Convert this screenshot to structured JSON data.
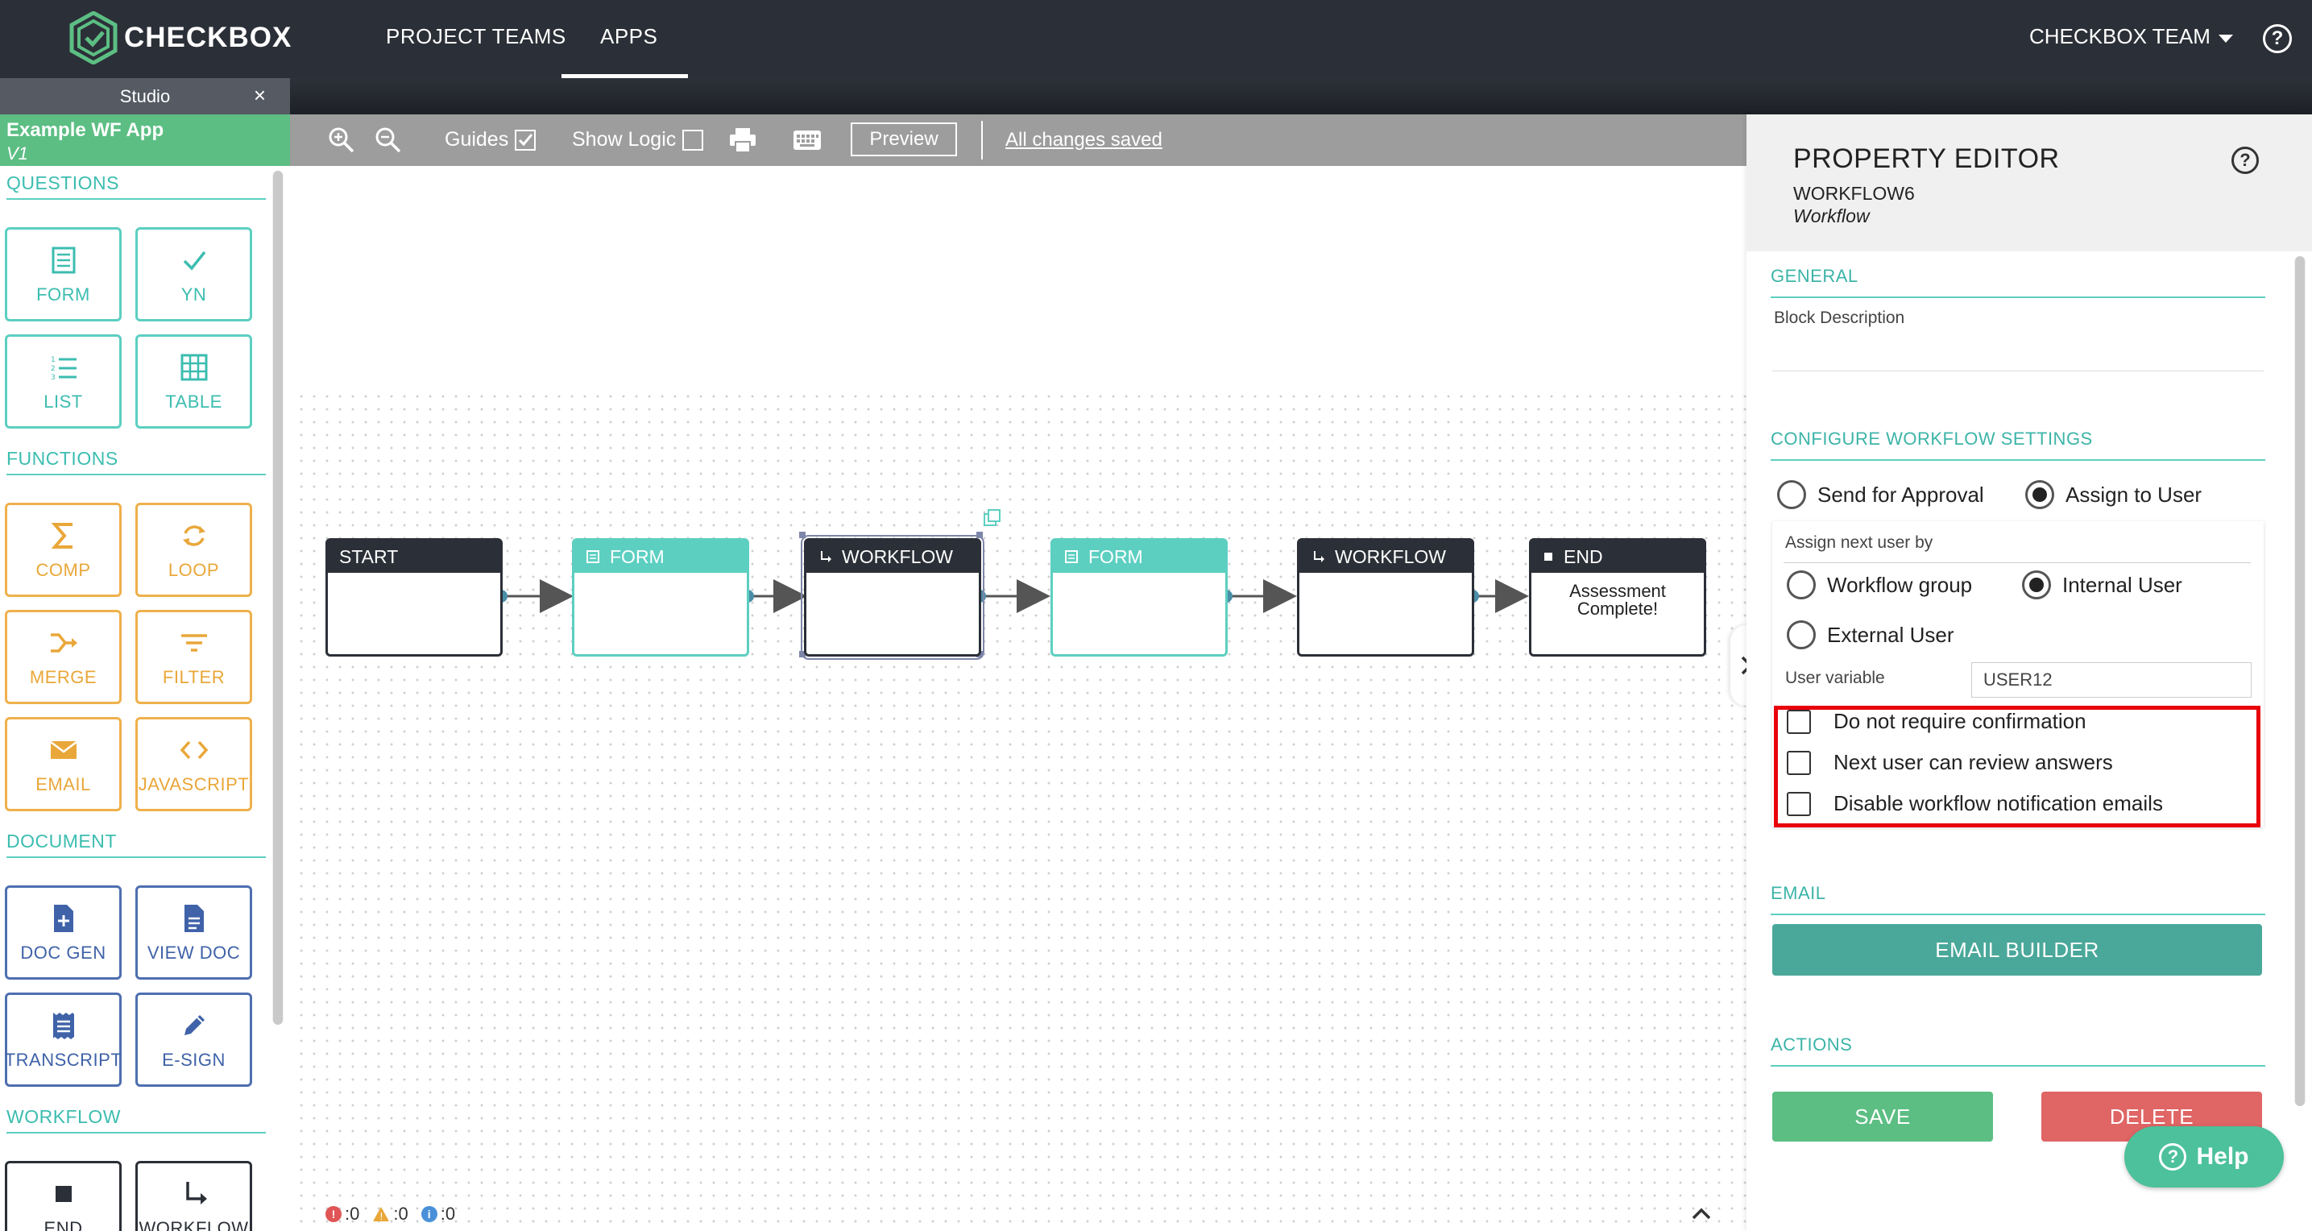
{
  "brand": {
    "name": "CHECKBOX",
    "accent": "#5cbe83"
  },
  "nav": {
    "tabs": [
      {
        "label": "PROJECT TEAMS"
      },
      {
        "label": "APPS"
      }
    ],
    "team_label": "CHECKBOX TEAM",
    "help_glyph": "?"
  },
  "studio": {
    "tab_label": "Studio",
    "close_glyph": "×"
  },
  "app": {
    "name": "Example WF App",
    "version": "V1"
  },
  "palette": {
    "questions": {
      "title": "QUESTIONS",
      "items": [
        "FORM",
        "YN",
        "LIST",
        "TABLE"
      ]
    },
    "functions": {
      "title": "FUNCTIONS",
      "items": [
        "COMP",
        "LOOP",
        "MERGE",
        "FILTER",
        "EMAIL",
        "JAVASCRIPT"
      ]
    },
    "document": {
      "title": "DOCUMENT",
      "items": [
        "DOC GEN",
        "VIEW DOC",
        "TRANSCRIPT",
        "E-SIGN"
      ]
    },
    "workflow": {
      "title": "WORKFLOW",
      "items": [
        "END",
        "WORKFLOW"
      ]
    }
  },
  "toolbar": {
    "guides_label": "Guides",
    "show_logic_label": "Show Logic",
    "preview_label": "Preview",
    "saved_label": "All changes saved"
  },
  "flow": {
    "nodes": [
      {
        "label": "START",
        "body": ""
      },
      {
        "label": "FORM",
        "body": ""
      },
      {
        "label": "WORKFLOW",
        "body": ""
      },
      {
        "label": "FORM",
        "body": ""
      },
      {
        "label": "WORKFLOW",
        "body": ""
      },
      {
        "label": "END",
        "body": "Assessment Complete!"
      }
    ]
  },
  "status": {
    "errors": ":0",
    "warnings": ":0",
    "info": ":0"
  },
  "property_editor": {
    "title": "PROPERTY EDITOR",
    "block_name": "WORKFLOW6",
    "block_type": "Workflow",
    "general": {
      "title": "GENERAL",
      "description_label": "Block Description"
    },
    "configure": {
      "title": "CONFIGURE WORKFLOW SETTINGS",
      "mode_options": [
        "Send for Approval",
        "Assign to User"
      ],
      "selected_mode": "Assign to User",
      "assign_by_label": "Assign next user by",
      "assign_options": [
        "Workflow group",
        "Internal User",
        "External User"
      ],
      "selected_assign": "Internal User",
      "user_variable_label": "User variable",
      "user_variable_value": "USER12",
      "checkboxes": [
        "Do not require confirmation",
        "Next user can review answers",
        "Disable workflow notification emails"
      ]
    },
    "email": {
      "title": "EMAIL",
      "builder_label": "EMAIL BUILDER"
    },
    "actions": {
      "title": "ACTIONS",
      "save_label": "SAVE",
      "delete_label": "DELETE"
    }
  },
  "help_widget": {
    "label": "Help"
  }
}
